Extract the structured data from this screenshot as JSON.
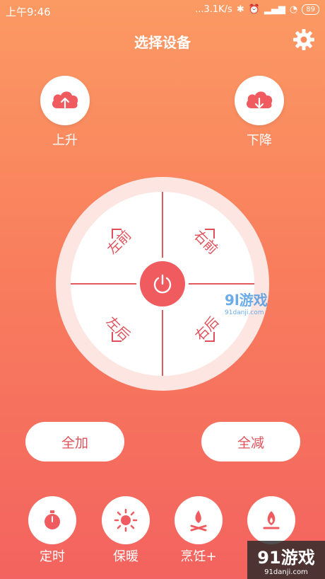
{
  "status": {
    "time": "上午9:46",
    "network": "...3.1K/s",
    "battery": "89",
    "icons": [
      "bluetooth-icon",
      "alarm-icon",
      "signal-icon",
      "wifi-icon"
    ]
  },
  "header": {
    "title": "选择设备"
  },
  "top_buttons": {
    "up_label": "上升",
    "down_label": "下降"
  },
  "dial": {
    "front_left": "左前",
    "front_right": "右前",
    "back_left": "左后",
    "back_right": "右后"
  },
  "pills": {
    "all_add": "全加",
    "all_reduce": "全减"
  },
  "functions": {
    "timer": "定时",
    "keep_warm": "保暖",
    "cook": "烹饪+"
  },
  "watermark": {
    "brand": "91游戏",
    "url": "91danji.com",
    "mid_brand": "9l游戏",
    "mid_url": "91danji.com"
  },
  "colors": {
    "accent": "#ef5b5f",
    "bg_top": "#fb9a63",
    "bg_bottom": "#f3635f"
  }
}
